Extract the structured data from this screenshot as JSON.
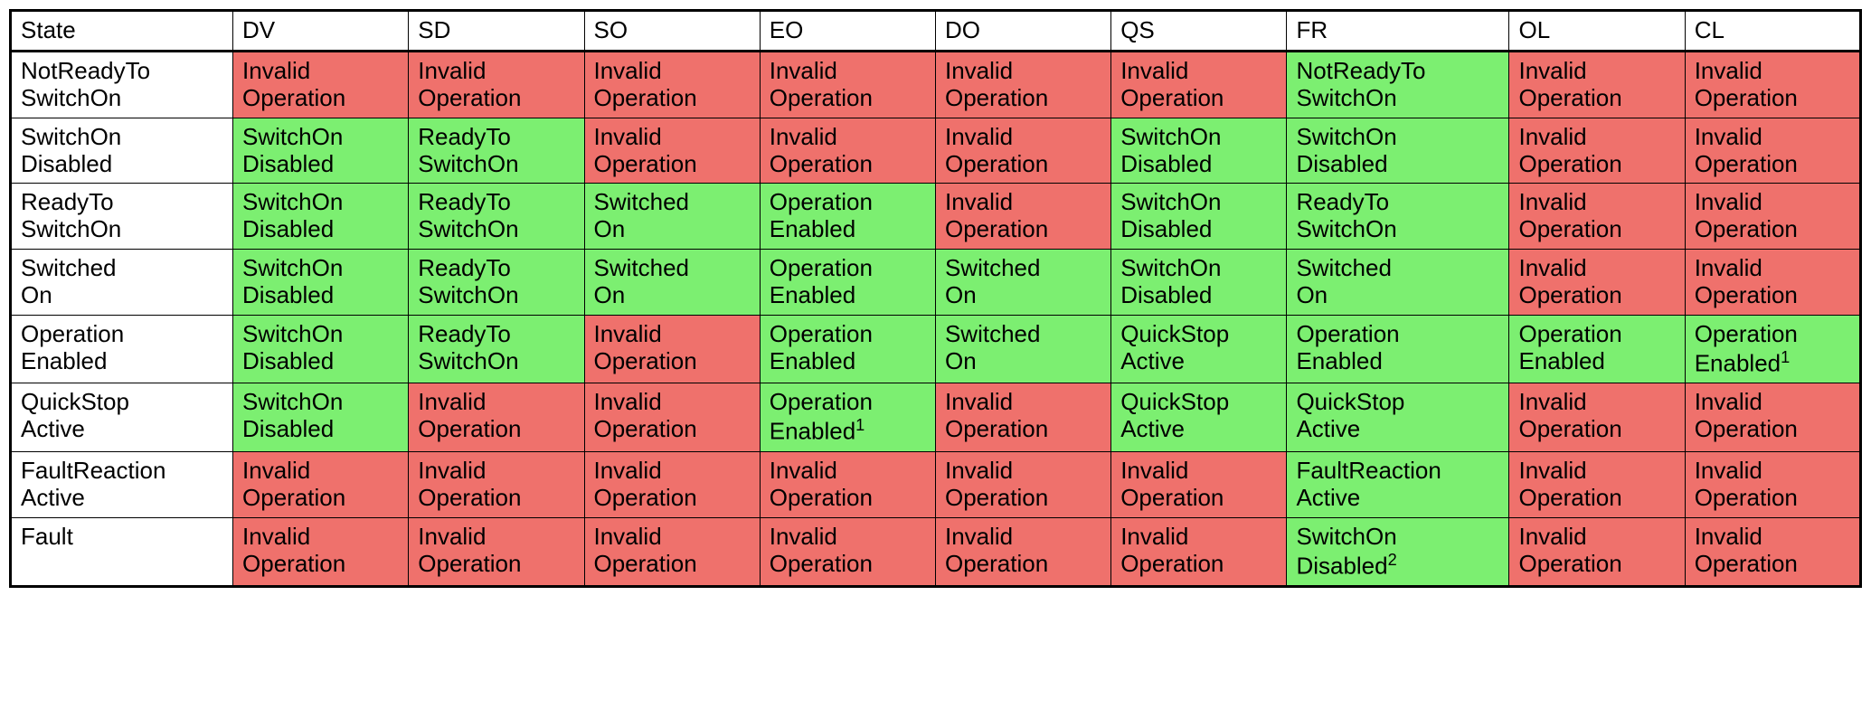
{
  "colors": {
    "valid": "#7CEF71",
    "invalid": "#EF716C"
  },
  "headers": [
    "State",
    "DV",
    "SD",
    "SO",
    "EO",
    "DO",
    "QS",
    "FR",
    "OL",
    "CL"
  ],
  "rows": [
    {
      "state": {
        "l1": "NotReadyTo",
        "l2": "SwitchOn"
      },
      "cells": [
        {
          "l1": "Invalid",
          "l2": "Operation",
          "valid": false
        },
        {
          "l1": "Invalid",
          "l2": "Operation",
          "valid": false
        },
        {
          "l1": "Invalid",
          "l2": "Operation",
          "valid": false
        },
        {
          "l1": "Invalid",
          "l2": "Operation",
          "valid": false
        },
        {
          "l1": "Invalid",
          "l2": "Operation",
          "valid": false
        },
        {
          "l1": "Invalid",
          "l2": "Operation",
          "valid": false
        },
        {
          "l1": "NotReadyTo",
          "l2": "SwitchOn",
          "valid": true
        },
        {
          "l1": "Invalid",
          "l2": "Operation",
          "valid": false
        },
        {
          "l1": "Invalid",
          "l2": "Operation",
          "valid": false
        }
      ]
    },
    {
      "state": {
        "l1": "SwitchOn",
        "l2": "Disabled"
      },
      "cells": [
        {
          "l1": "SwitchOn",
          "l2": "Disabled",
          "valid": true
        },
        {
          "l1": "ReadyTo",
          "l2": "SwitchOn",
          "valid": true
        },
        {
          "l1": "Invalid",
          "l2": "Operation",
          "valid": false
        },
        {
          "l1": "Invalid",
          "l2": "Operation",
          "valid": false
        },
        {
          "l1": "Invalid",
          "l2": "Operation",
          "valid": false
        },
        {
          "l1": "SwitchOn",
          "l2": "Disabled",
          "valid": true
        },
        {
          "l1": "SwitchOn",
          "l2": "Disabled",
          "valid": true
        },
        {
          "l1": "Invalid",
          "l2": "Operation",
          "valid": false
        },
        {
          "l1": "Invalid",
          "l2": "Operation",
          "valid": false
        }
      ]
    },
    {
      "state": {
        "l1": "ReadyTo",
        "l2": "SwitchOn"
      },
      "cells": [
        {
          "l1": "SwitchOn",
          "l2": "Disabled",
          "valid": true
        },
        {
          "l1": "ReadyTo",
          "l2": "SwitchOn",
          "valid": true
        },
        {
          "l1": "Switched",
          "l2": "On",
          "valid": true
        },
        {
          "l1": "Operation",
          "l2": "Enabled",
          "valid": true
        },
        {
          "l1": "Invalid",
          "l2": "Operation",
          "valid": false
        },
        {
          "l1": "SwitchOn",
          "l2": "Disabled",
          "valid": true
        },
        {
          "l1": "ReadyTo",
          "l2": "SwitchOn",
          "valid": true
        },
        {
          "l1": "Invalid",
          "l2": "Operation",
          "valid": false
        },
        {
          "l1": "Invalid",
          "l2": "Operation",
          "valid": false
        }
      ]
    },
    {
      "state": {
        "l1": "Switched",
        "l2": "On"
      },
      "cells": [
        {
          "l1": "SwitchOn",
          "l2": "Disabled",
          "valid": true
        },
        {
          "l1": "ReadyTo",
          "l2": "SwitchOn",
          "valid": true
        },
        {
          "l1": "Switched",
          "l2": "On",
          "valid": true
        },
        {
          "l1": "Operation",
          "l2": "Enabled",
          "valid": true
        },
        {
          "l1": "Switched",
          "l2": "On",
          "valid": true
        },
        {
          "l1": "SwitchOn",
          "l2": "Disabled",
          "valid": true
        },
        {
          "l1": "Switched",
          "l2": "On",
          "valid": true
        },
        {
          "l1": "Invalid",
          "l2": "Operation",
          "valid": false
        },
        {
          "l1": "Invalid",
          "l2": "Operation",
          "valid": false
        }
      ]
    },
    {
      "state": {
        "l1": "Operation",
        "l2": "Enabled"
      },
      "cells": [
        {
          "l1": "SwitchOn",
          "l2": "Disabled",
          "valid": true
        },
        {
          "l1": "ReadyTo",
          "l2": "SwitchOn",
          "valid": true
        },
        {
          "l1": "Invalid",
          "l2": "Operation",
          "valid": false
        },
        {
          "l1": "Operation",
          "l2": "Enabled",
          "valid": true
        },
        {
          "l1": "Switched",
          "l2": "On",
          "valid": true
        },
        {
          "l1": "QuickStop",
          "l2": "Active",
          "valid": true
        },
        {
          "l1": "Operation",
          "l2": "Enabled",
          "valid": true
        },
        {
          "l1": "Operation",
          "l2": "Enabled",
          "valid": true
        },
        {
          "l1": "Operation",
          "l2": "Enabled",
          "sup": "1",
          "valid": true
        }
      ]
    },
    {
      "state": {
        "l1": "QuickStop",
        "l2": "Active"
      },
      "cells": [
        {
          "l1": "SwitchOn",
          "l2": "Disabled",
          "valid": true
        },
        {
          "l1": "Invalid",
          "l2": "Operation",
          "valid": false
        },
        {
          "l1": "Invalid",
          "l2": "Operation",
          "valid": false
        },
        {
          "l1": "Operation",
          "l2": "Enabled",
          "sup": "1",
          "valid": true
        },
        {
          "l1": "Invalid",
          "l2": "Operation",
          "valid": false
        },
        {
          "l1": "QuickStop",
          "l2": "Active",
          "valid": true
        },
        {
          "l1": "QuickStop",
          "l2": "Active",
          "valid": true
        },
        {
          "l1": "Invalid",
          "l2": "Operation",
          "valid": false
        },
        {
          "l1": "Invalid",
          "l2": "Operation",
          "valid": false
        }
      ]
    },
    {
      "state": {
        "l1": "FaultReaction",
        "l2": "Active"
      },
      "cells": [
        {
          "l1": "Invalid",
          "l2": "Operation",
          "valid": false
        },
        {
          "l1": "Invalid",
          "l2": "Operation",
          "valid": false
        },
        {
          "l1": "Invalid",
          "l2": "Operation",
          "valid": false
        },
        {
          "l1": "Invalid",
          "l2": "Operation",
          "valid": false
        },
        {
          "l1": "Invalid",
          "l2": "Operation",
          "valid": false
        },
        {
          "l1": "Invalid",
          "l2": "Operation",
          "valid": false
        },
        {
          "l1": "FaultReaction",
          "l2": "Active",
          "valid": true
        },
        {
          "l1": "Invalid",
          "l2": "Operation",
          "valid": false
        },
        {
          "l1": "Invalid",
          "l2": "Operation",
          "valid": false
        }
      ]
    },
    {
      "state": {
        "l1": "Fault",
        "l2": ""
      },
      "cells": [
        {
          "l1": "Invalid",
          "l2": "Operation",
          "valid": false
        },
        {
          "l1": "Invalid",
          "l2": "Operation",
          "valid": false
        },
        {
          "l1": "Invalid",
          "l2": "Operation",
          "valid": false
        },
        {
          "l1": "Invalid",
          "l2": "Operation",
          "valid": false
        },
        {
          "l1": "Invalid",
          "l2": "Operation",
          "valid": false
        },
        {
          "l1": "Invalid",
          "l2": "Operation",
          "valid": false
        },
        {
          "l1": "SwitchOn",
          "l2": "Disabled",
          "sup": "2",
          "valid": true
        },
        {
          "l1": "Invalid",
          "l2": "Operation",
          "valid": false
        },
        {
          "l1": "Invalid",
          "l2": "Operation",
          "valid": false
        }
      ]
    }
  ]
}
